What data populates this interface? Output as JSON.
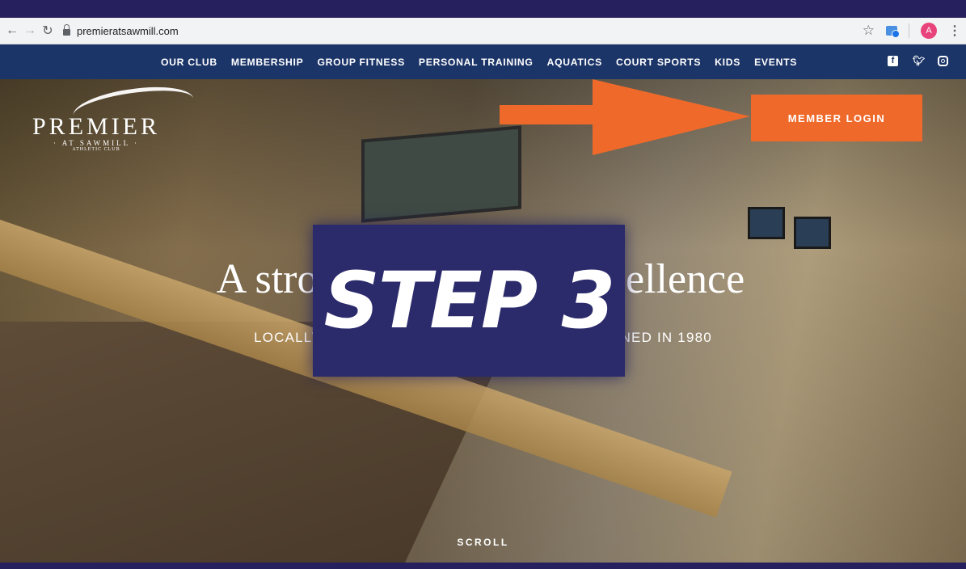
{
  "browser": {
    "url": "premieratsawmill.com",
    "avatar_letter": "A",
    "icons": [
      "back-icon",
      "forward-icon",
      "reload-icon",
      "lock-icon",
      "star-icon",
      "extension-icon",
      "menu-icon"
    ]
  },
  "nav": {
    "items": [
      "OUR CLUB",
      "MEMBERSHIP",
      "GROUP FITNESS",
      "PERSONAL TRAINING",
      "AQUATICS",
      "COURT SPORTS",
      "KIDS",
      "EVENTS"
    ],
    "social_icons": [
      "facebook-icon",
      "twitter-icon",
      "instagram-icon"
    ]
  },
  "logo": {
    "name": "PREMIER",
    "sub": "· AT SAWMILL ·",
    "sub2": "ATHLETIC CLUB"
  },
  "hero": {
    "login_label": "MEMBER LOGIN",
    "headline_left": "A strong t",
    "headline_right": "xcellence",
    "tagline_left": "LOCALLY OW",
    "tagline_right": "ENED IN 1980",
    "scroll_label": "SCROLL"
  },
  "overlay": {
    "step_label": "STEP 3",
    "arrow_color": "#ef6a2a",
    "step_bg": "#2b2a6b"
  },
  "colors": {
    "frame": "#26215e",
    "nav_bg": "#1c3568",
    "accent": "#ef6a2a"
  }
}
